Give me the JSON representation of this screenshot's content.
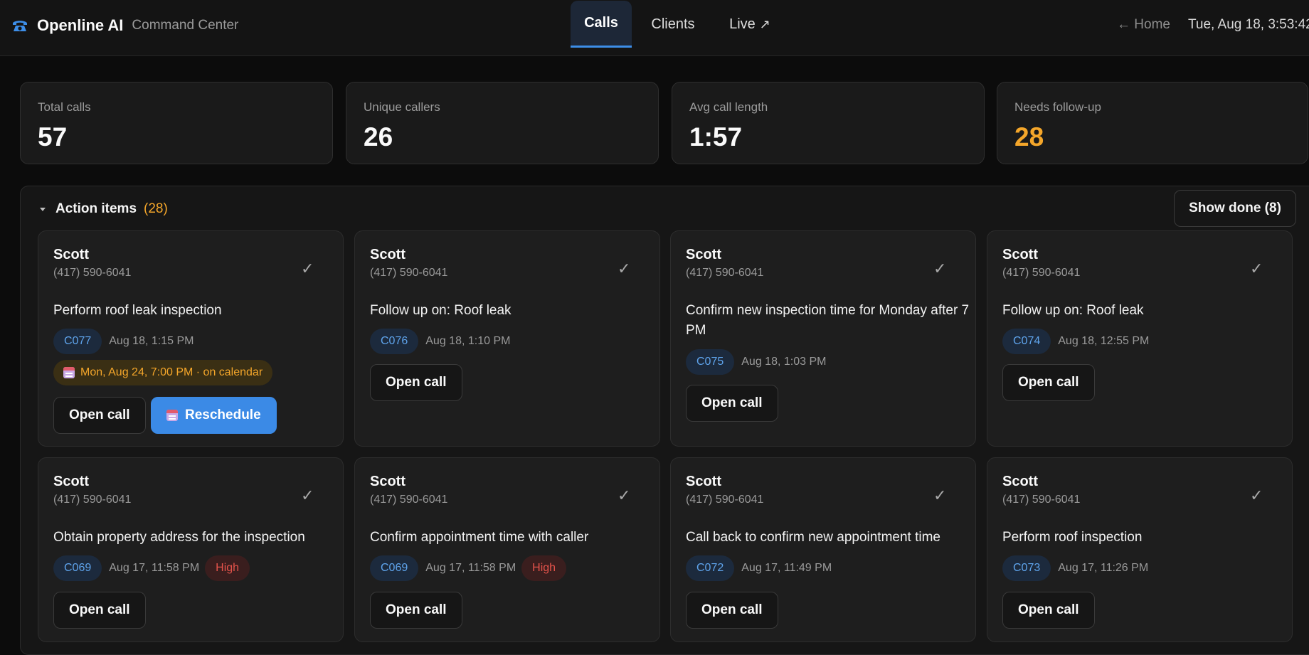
{
  "header": {
    "app_title": "Openline AI",
    "subtitle": "Command Center",
    "phone_icon": "telephone-icon",
    "tabs": [
      {
        "label": "Calls",
        "active": true
      },
      {
        "label": "Clients",
        "active": false
      },
      {
        "label": "Live",
        "active": false,
        "suffix": "↗"
      }
    ],
    "home_link": "← Home",
    "datetime": "Tue, Aug 18, 3:53:42"
  },
  "stats": [
    {
      "label": "Total calls",
      "value": "57"
    },
    {
      "label": "Unique callers",
      "value": "26"
    },
    {
      "label": "Avg call length",
      "value": "1:57"
    },
    {
      "label": "Needs follow-up",
      "value": "28",
      "color": "#f4a62a"
    }
  ],
  "action_items": {
    "title": "Action items",
    "count": "(28)",
    "show_done_label": "Show done (8)",
    "open_call_label": "Open call",
    "reschedule_label": "Reschedule",
    "check_glyph": "✓",
    "cards": [
      {
        "name": "Scott",
        "phone": "(417) 590-6041",
        "task": "Perform roof leak inspection",
        "call_id": "C077",
        "when": "Aug 18, 1:15 PM",
        "calendar": "Mon, Aug 24, 7:00 PM · on calendar"
      },
      {
        "name": "Scott",
        "phone": "(417) 590-6041",
        "task": "Follow up on: Roof leak",
        "call_id": "C076",
        "when": "Aug 18, 1:10 PM"
      },
      {
        "name": "Scott",
        "phone": "(417) 590-6041",
        "task": "Confirm new inspection time for Monday after 7 PM",
        "call_id": "C075",
        "when": "Aug 18, 1:03 PM"
      },
      {
        "name": "Scott",
        "phone": "(417) 590-6041",
        "task": "Follow up on: Roof leak",
        "call_id": "C074",
        "when": "Aug 18, 12:55 PM"
      },
      {
        "name": "Scott",
        "phone": "(417) 590-6041",
        "task": "Obtain property address for the inspection",
        "call_id": "C069",
        "when": "Aug 17, 11:58 PM",
        "priority": "High"
      },
      {
        "name": "Scott",
        "phone": "(417) 590-6041",
        "task": "Confirm appointment time with caller",
        "call_id": "C069",
        "when": "Aug 17, 11:58 PM",
        "priority": "High"
      },
      {
        "name": "Scott",
        "phone": "(417) 590-6041",
        "task": "Call back to confirm new appointment time",
        "call_id": "C072",
        "when": "Aug 17, 11:49 PM"
      },
      {
        "name": "Scott",
        "phone": "(417) 590-6041",
        "task": "Perform roof inspection",
        "call_id": "C073",
        "when": "Aug 17, 11:26 PM"
      }
    ]
  },
  "colors": {
    "accent": "#3b8ae6",
    "warning": "#f4a62a",
    "danger": "#e5534b",
    "id_pill_text": "#5fa4ec"
  }
}
